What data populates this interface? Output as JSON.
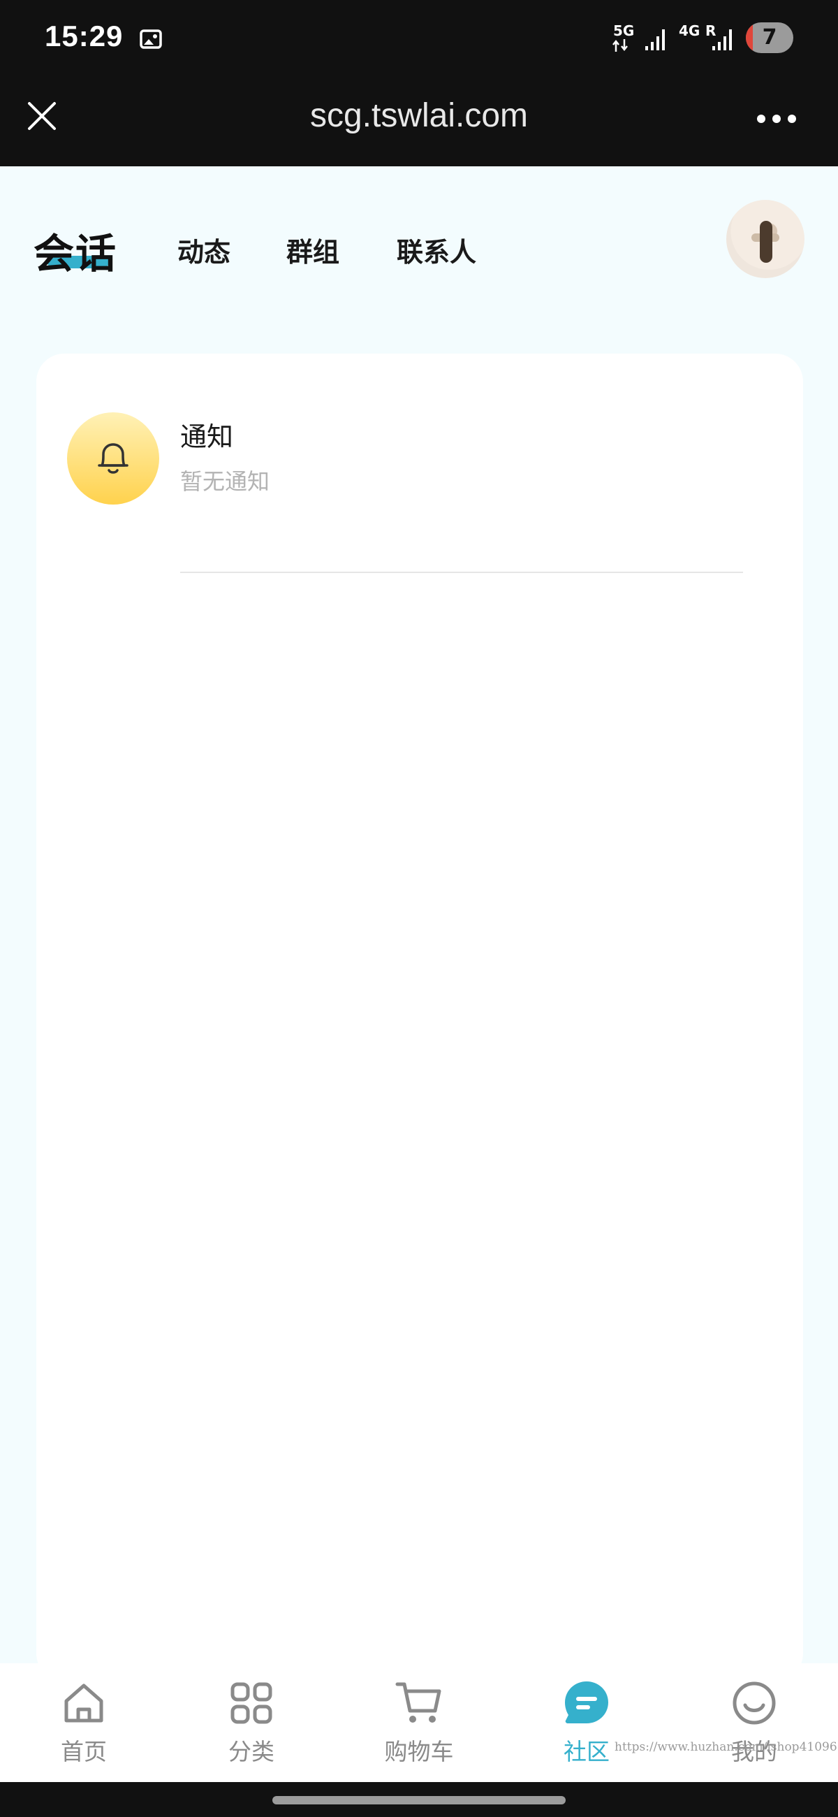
{
  "status_bar": {
    "time": "15:29",
    "network_5g": "5G",
    "network_4g": "4G",
    "roaming": "R",
    "battery": "7",
    "icons": [
      "screenshot-icon",
      "signal-icon",
      "signal-icon"
    ]
  },
  "browser": {
    "url": "scg.tswlai.com",
    "icons": [
      "close-icon",
      "more-icon"
    ]
  },
  "tabs": {
    "active": "会话",
    "items": [
      "动态",
      "群组",
      "联系人"
    ]
  },
  "notification": {
    "title": "通知",
    "subtitle": "暂无通知",
    "icon": "bell-icon"
  },
  "bottom_nav": {
    "items": [
      {
        "label": "首页",
        "icon": "home-icon"
      },
      {
        "label": "分类",
        "icon": "grid-icon"
      },
      {
        "label": "购物车",
        "icon": "cart-icon"
      },
      {
        "label": "社区",
        "icon": "chat-icon",
        "active": true
      },
      {
        "label": "我的",
        "icon": "smile-icon"
      }
    ]
  },
  "watermark": "https://www.huzhan.com/ishop41096",
  "colors": {
    "accent": "#35b0cc",
    "page_bg": "#f3fcfe",
    "bar_bg": "#111111",
    "bell_gradient_top": "#fff1b6",
    "bell_gradient_bottom": "#ffd24d"
  }
}
